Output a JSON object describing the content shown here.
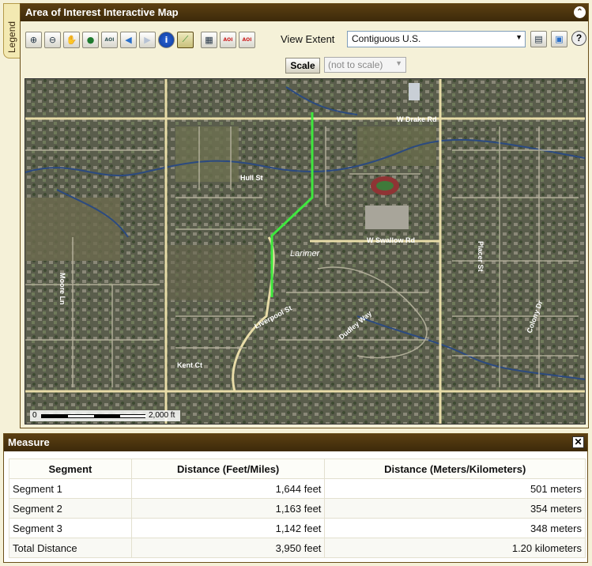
{
  "legend_tab": {
    "label": "Legend"
  },
  "map_panel": {
    "title": "Area of Interest Interactive Map",
    "toolbar": [
      {
        "name": "zoom-in-icon",
        "glyph": "🔍"
      },
      {
        "name": "zoom-out-icon",
        "glyph": "🔎"
      },
      {
        "name": "pan-hand-icon",
        "glyph": "✋"
      },
      {
        "name": "full-extent-globe-icon",
        "glyph": "◉"
      },
      {
        "name": "zoom-to-aoi-icon",
        "glyph": "AOI"
      },
      {
        "name": "previous-extent-icon",
        "glyph": "◀"
      },
      {
        "name": "next-extent-icon",
        "glyph": "▶"
      },
      {
        "name": "identify-info-icon",
        "glyph": "i"
      },
      {
        "name": "measure-ruler-icon",
        "glyph": "📏"
      },
      {
        "name": "select-features-icon",
        "glyph": "▦"
      },
      {
        "name": "clear-aoi-icon",
        "glyph": "AOI"
      },
      {
        "name": "draw-aoi-icon",
        "glyph": "AOI"
      }
    ],
    "view_extent_label": "View Extent",
    "view_extent_value": "Contiguous U.S.",
    "scale_button": "Scale",
    "scale_value": "(not to scale)",
    "help_glyph": "?",
    "collapse_glyph": "⌃"
  },
  "map": {
    "street_labels": [
      "W Drake Rd",
      "Hull St",
      "W Swallow Rd",
      "Larimer",
      "Moore Ln",
      "Liverpool St",
      "Dudley Way",
      "Kent Ct",
      "Placer St",
      "Colony Dr"
    ],
    "scale": {
      "zero": "0",
      "distance": "2,000 ft"
    },
    "measure_line_color": "#3ee83e",
    "road_color": "#e8dca8"
  },
  "measure": {
    "title": "Measure",
    "close_glyph": "✕",
    "columns": [
      "Segment",
      "Distance (Feet/Miles)",
      "Distance (Meters/Kilometers)"
    ],
    "rows": [
      {
        "segment": "Segment 1",
        "feet": "1,644 feet",
        "meters": "501 meters"
      },
      {
        "segment": "Segment 2",
        "feet": "1,163 feet",
        "meters": "354 meters"
      },
      {
        "segment": "Segment 3",
        "feet": "1,142 feet",
        "meters": "348 meters"
      },
      {
        "segment": "Total Distance",
        "feet": "3,950 feet",
        "meters": "1.20 kilometers"
      }
    ]
  }
}
